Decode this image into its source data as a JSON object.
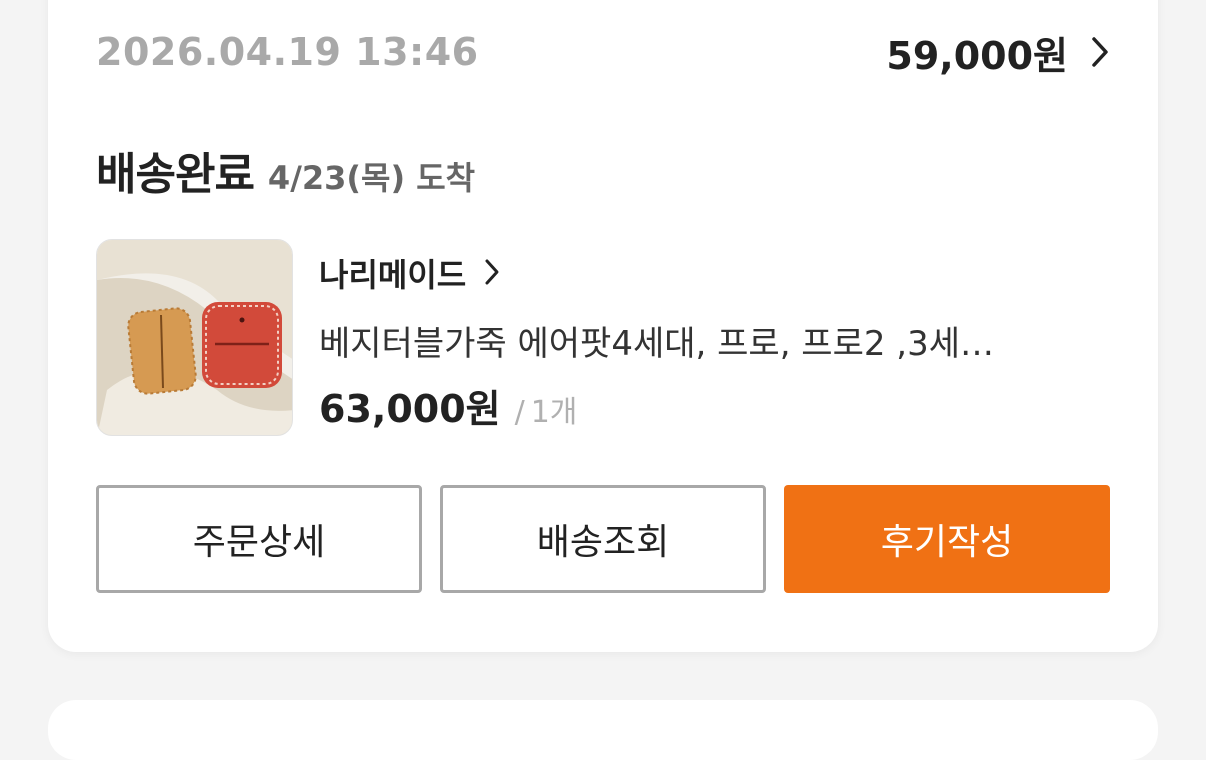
{
  "order": {
    "datetime": "2026.04.19 13:46",
    "total_price": "59,000원"
  },
  "status": {
    "label": "배송완료",
    "arrival": "4/23(목) 도착"
  },
  "item": {
    "seller": "나리메이드",
    "name": "베지터블가죽 에어팟4세대, 프로, 프로2 ,3세…",
    "price": "63,000원",
    "qty_separator": "/",
    "quantity": "1개"
  },
  "actions": {
    "detail_label": "주문상세",
    "track_label": "배송조회",
    "review_label": "후기작성"
  },
  "icons": {
    "total_chevron": "chevron-right-icon",
    "seller_chevron": "chevron-right-icon",
    "product_image": "airpods-leather-case-photo"
  },
  "colors": {
    "accent": "#f07114",
    "date_gray": "#a9a9a9",
    "text_dark": "#222222"
  }
}
